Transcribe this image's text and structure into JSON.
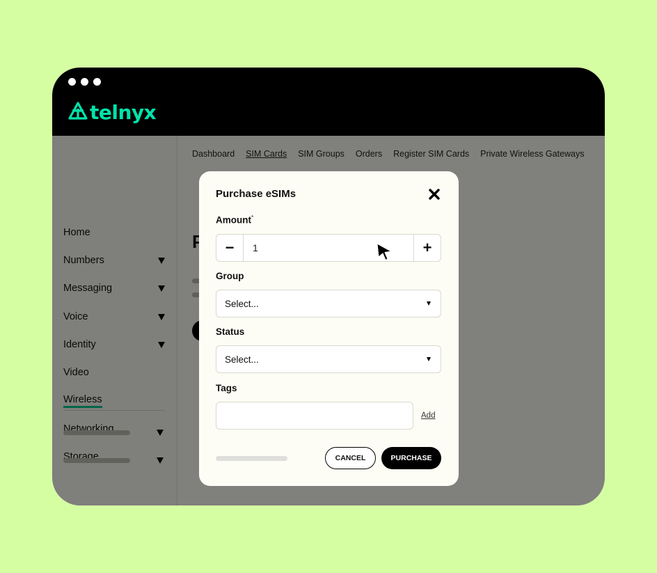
{
  "window": {
    "dots": [
      "dot",
      "dot",
      "dot"
    ],
    "logo_text": "telnyx",
    "logo_icon": "telnyx-logo-icon"
  },
  "sidebar": {
    "items": [
      {
        "label": "Home",
        "has_dropdown": false
      },
      {
        "label": "Numbers",
        "has_dropdown": true
      },
      {
        "label": "Messaging",
        "has_dropdown": true
      },
      {
        "label": "Voice",
        "has_dropdown": true
      },
      {
        "label": "Identity",
        "has_dropdown": true
      },
      {
        "label": "Video",
        "has_dropdown": false
      },
      {
        "label": "Wireless",
        "has_dropdown": false,
        "active": true
      },
      {
        "label": "Networking",
        "has_dropdown": false
      },
      {
        "label": "Storage",
        "has_dropdown": false
      }
    ]
  },
  "main": {
    "tabs": [
      {
        "label": "Dashboard"
      },
      {
        "label": "SIM Cards",
        "active": true
      },
      {
        "label": "SIM Groups"
      },
      {
        "label": "Orders"
      },
      {
        "label": "Register SIM Cards"
      },
      {
        "label": "Private Wireless Gateways"
      }
    ],
    "heading_partial": "P"
  },
  "modal": {
    "title": "Purchase eSIMs",
    "close_icon": "close-icon",
    "amount_label": "Amount",
    "amount_required_mark": "*",
    "amount_minus": "−",
    "amount_value": "1",
    "amount_plus": "+",
    "group_label": "Group",
    "group_placeholder": "Select...",
    "status_label": "Status",
    "status_placeholder": "Select...",
    "tags_label": "Tags",
    "tags_add": "Add",
    "cancel_label": "CANCEL",
    "purchase_label": "PURCHASE"
  },
  "colors": {
    "background": "#d5fea3",
    "brand": "#00e3aa",
    "active_underline": "#00c48c"
  }
}
